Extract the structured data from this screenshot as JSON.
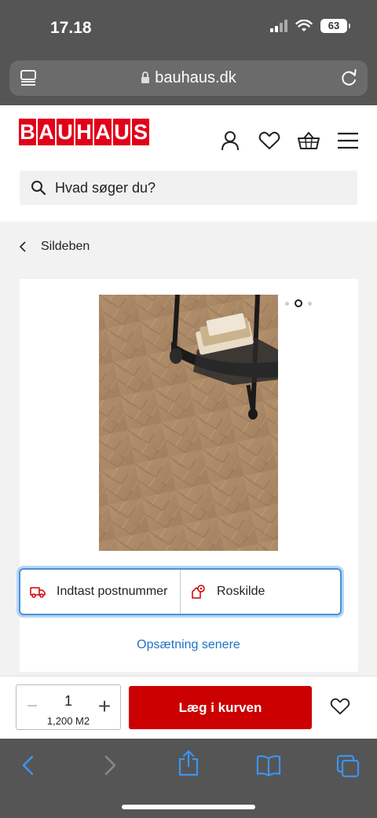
{
  "status_bar": {
    "time": "17.18",
    "battery": "63"
  },
  "browser": {
    "url": "bauhaus.dk"
  },
  "header": {
    "logo_letters": [
      "B",
      "A",
      "U",
      "H",
      "A",
      "U",
      "S"
    ],
    "icons": [
      "account-icon",
      "wishlist-heart-icon",
      "basket-icon",
      "menu-icon"
    ]
  },
  "search": {
    "placeholder": "Hvad søger du?"
  },
  "breadcrumb": {
    "label": "Sildeben"
  },
  "product": {
    "image_alt": "herringbone oak floor with trolley",
    "carousel": {
      "count": 3,
      "active_index": 1
    }
  },
  "delivery": {
    "postcode_label": "Indtast postnummer",
    "store_label": "Roskilde",
    "setup_later": "Opsætning senere"
  },
  "cart": {
    "quantity": "1",
    "unit": "1,200 M2",
    "add_label": "Læg i kurven"
  },
  "colors": {
    "brand": "#e2001a",
    "cta": "#cc0000",
    "link": "#1d72c9",
    "focus": "#4a8fd8"
  }
}
